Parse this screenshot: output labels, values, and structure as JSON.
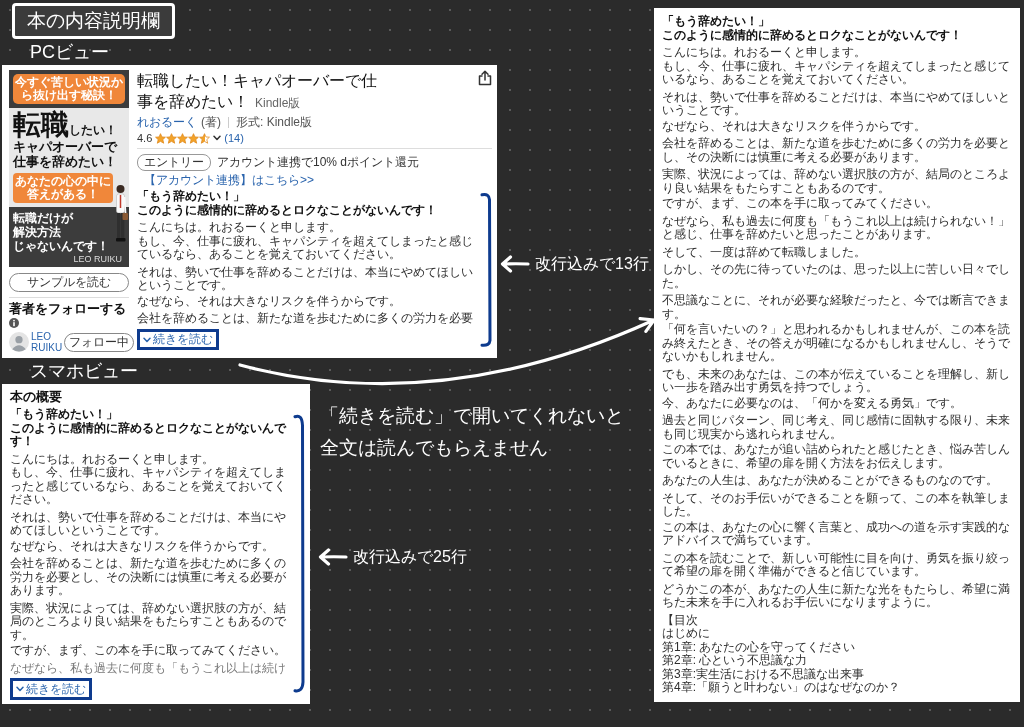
{
  "page_title": "本の内容説明欄",
  "pc_view": {
    "label": "PCビュー",
    "cover": {
      "banner": "今すぐ苦しい状況から抜け出す秘訣！",
      "title_large": "転職",
      "title_small": "したい！",
      "title_lines": [
        "キャパオーバーで",
        "仕事を辞めたい！"
      ],
      "callout": [
        "あなたの心の中に",
        "答えがある！"
      ],
      "tagline": [
        "転職だけが",
        "解決方法",
        "じゃないんです！"
      ],
      "author": "LEO RUIKU"
    },
    "sample_button": "サンプルを読む",
    "follow_heading": "著者をフォローする",
    "author_name": "LEO RUIKU",
    "follow_button": "フォロー中",
    "book_title": "転職したい！キャパオーバーで仕事を辞めたい！",
    "format_label": "Kindle版",
    "author_link": "れおるーく",
    "author_role": "(著)",
    "format": "形式: Kindle版",
    "rating": "4.6",
    "stars": 4.5,
    "review_count": "(14)",
    "badge": "エントリー",
    "promo": "アカウント連携で10% dポイント還元",
    "promo_link": "【アカウント連携】はこちら>>",
    "description": {
      "lead": [
        "「もう辞めたい！」",
        "このように感情的に辞めるとロクなことがないんです！"
      ],
      "groups": [
        [
          [
            "こんにちは。れおるーくと申します。",
            "もし、今、仕事に疲れ、キャパシティを超えてしまったと感じているなら、あることを覚えておいてください。"
          ]
        ],
        [
          [
            "それは、勢いで仕事を辞めることだけは、本当にやめてほしいということです。"
          ],
          [
            "なぜなら、それは大きなリスクを伴うからです。"
          ]
        ],
        [
          [
            "会社を辞めることは、新たな道を歩むために多くの労力を必要"
          ]
        ]
      ]
    },
    "read_more": "続きを読む",
    "note": "改行込みで13行"
  },
  "callout": [
    "「続きを読む」で開いてくれないと",
    "全文は読んでもらえません"
  ],
  "sp_view": {
    "label": "スマホビュー",
    "heading": "本の概要",
    "description": {
      "lead": [
        "「もう辞めたい！」",
        "このように感情的に辞めるとロクなことがないんです！"
      ],
      "groups": [
        [
          [
            "こんにちは。れおるーくと申します。",
            "もし、今、仕事に疲れ、キャパシティを超えてしまったと感じているなら、あることを覚えておいてください。"
          ]
        ],
        [
          [
            "それは、勢いで仕事を辞めることだけは、本当にやめてほしいということです。"
          ],
          [
            "なぜなら、それは大きなリスクを伴うからです。"
          ]
        ],
        [
          [
            "会社を辞めることは、新たな道を歩むために多くの労力を必要とし、その決断には慎重に考える必要があります。"
          ]
        ],
        [
          [
            "実際、状況によっては、辞めない選択肢の方が、結局のところより良い結果をもたらすこともあるのです。"
          ],
          [
            "ですが、まず、この本を手に取ってみてください。"
          ]
        ],
        [
          [
            "なぜなら、私も過去に何度も「もうこれ以上は続け"
          ]
        ]
      ]
    },
    "read_more": "続きを読む",
    "note": "改行込みで25行"
  },
  "full_view": {
    "description": {
      "lead": [
        "「もう辞めたい！」",
        "このように感情的に辞めるとロクなことがないんです！"
      ],
      "groups": [
        [
          [
            "こんにちは。れおるーくと申します。",
            "もし、今、仕事に疲れ、キャパシティを超えてしまったと感じているなら、あることを覚えておいてください。"
          ]
        ],
        [
          [
            "それは、勢いで仕事を辞めることだけは、本当にやめてほしいということです。"
          ],
          [
            "なぜなら、それは大きなリスクを伴うからです。"
          ]
        ],
        [
          [
            "会社を辞めることは、新たな道を歩むために多くの労力を必要とし、その決断には慎重に考える必要があります。"
          ]
        ],
        [
          [
            "実際、状況によっては、辞めない選択肢の方が、結局のところより良い結果をもたらすこともあるのです。"
          ],
          [
            "ですが、まず、この本を手に取ってみてください。"
          ]
        ],
        [
          [
            "なぜなら、私も過去に何度も「もうこれ以上は続けられない！」と感じ、仕事を辞めたいと思ったことがあります。"
          ]
        ],
        [
          [
            "そして、一度は辞めて転職しました。"
          ]
        ],
        [
          [
            "しかし、その先に待っていたのは、思った以上に苦しい日々でした。"
          ]
        ],
        [
          [
            "不思議なことに、それが必要な経験だったと、今では断言できます。"
          ],
          [
            "「何を言いたいの？」と思われるかもしれませんが、この本を読み終えたとき、その答えが明確になるかもしれませんし、そうでないかもしれません。"
          ]
        ],
        [
          [
            "でも、未来のあなたは、この本が伝えていることを理解し、新しい一歩を踏み出す勇気を持つでしょう。"
          ],
          [
            "今、あなたに必要なのは、「何かを変える勇気」です。"
          ]
        ],
        [
          [
            "過去と同じパターン、同じ考え、同じ感情に固執する限り、未来も同じ現実から逃れられません。"
          ],
          [
            "この本では、あなたが追い詰められたと感じたとき、悩み苦しんでいるときに、希望の扉を開く方法をお伝えします。"
          ]
        ],
        [
          [
            "あなたの人生は、あなたが決めることができるものなのです。"
          ]
        ],
        [
          [
            "そして、そのお手伝いができることを願って、この本を執筆しました。"
          ],
          [
            "この本は、あなたの心に響く言葉と、成功への道を示す実践的なアドバイスで満ちています。"
          ]
        ],
        [
          [
            "この本を読むことで、新しい可能性に目を向け、勇気を振り絞って希望の扉を開く準備ができると信じています。"
          ]
        ],
        [
          [
            "どうかこの本が、あなたの人生に新たな光をもたらし、希望に満ちた未来を手に入れるお手伝いになりますように。"
          ]
        ]
      ],
      "toc": [
        "【目次",
        "はじめに",
        "第1章: あなたの心を守ってください",
        "第2章: 心という不思議な力",
        "第3章:実生活における不思議な出来事",
        "第4章:「願うと叶わない」のはなぜなのか？"
      ]
    }
  }
}
